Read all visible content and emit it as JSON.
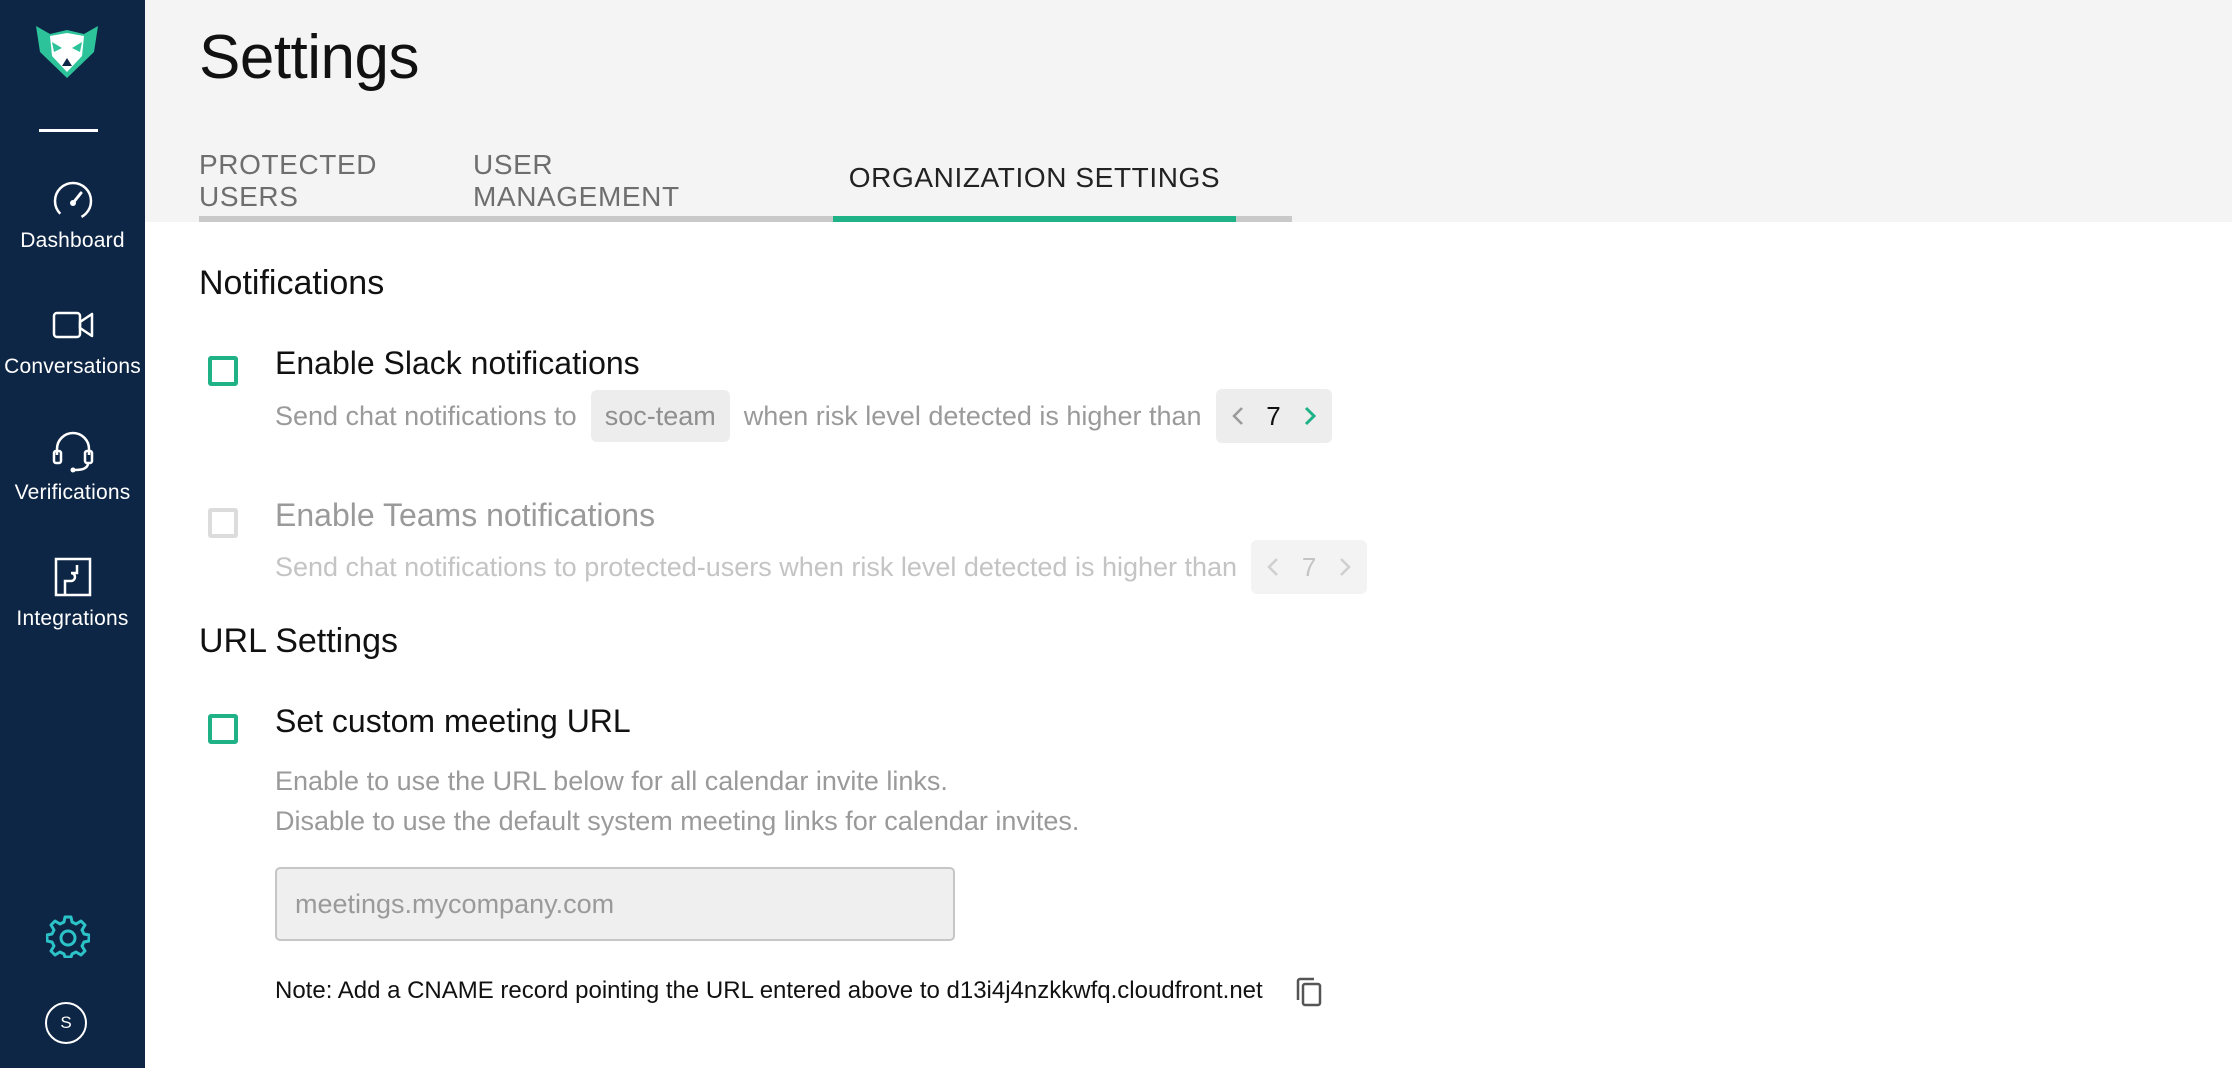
{
  "sidebar": {
    "items": [
      {
        "label": "Dashboard",
        "icon": "speedometer-icon"
      },
      {
        "label": "Conversations",
        "icon": "video-camera-icon"
      },
      {
        "label": "Verifications",
        "icon": "headset-icon"
      },
      {
        "label": "Integrations",
        "icon": "puzzle-icon"
      }
    ],
    "settings_icon": "gear-icon",
    "avatar_initial": "S"
  },
  "header": {
    "title": "Settings",
    "tabs": [
      {
        "label": "PROTECTED USERS",
        "active": false
      },
      {
        "label": "USER MANAGEMENT",
        "active": false
      },
      {
        "label": "ORGANIZATION SETTINGS",
        "active": true
      }
    ]
  },
  "notifications": {
    "title": "Notifications",
    "slack": {
      "label": "Enable Slack notifications",
      "checked": false,
      "text_before": "Send chat notifications to",
      "channel": "soc-team",
      "text_after": "when risk level detected is higher than",
      "risk_level": "7"
    },
    "teams": {
      "label": "Enable Teams notifications",
      "checked": false,
      "disabled": true,
      "text": "Send chat notifications to protected-users when risk level detected is higher than",
      "risk_level": "7"
    }
  },
  "url_settings": {
    "title": "URL Settings",
    "custom_url": {
      "label": "Set custom meeting URL",
      "checked": false,
      "desc_line1": "Enable to use the URL below for all calendar invite links.",
      "desc_line2": "Disable to use the default system meeting links for calendar invites.",
      "input_value": "",
      "input_placeholder": "meetings.mycompany.com",
      "note": "Note: Add a CNAME record pointing the URL entered above to d13i4j4nzkkwfq.cloudfront.net"
    }
  },
  "colors": {
    "sidebar_bg": "#0e2645",
    "accent": "#1fb287",
    "header_bg": "#f4f4f4"
  }
}
